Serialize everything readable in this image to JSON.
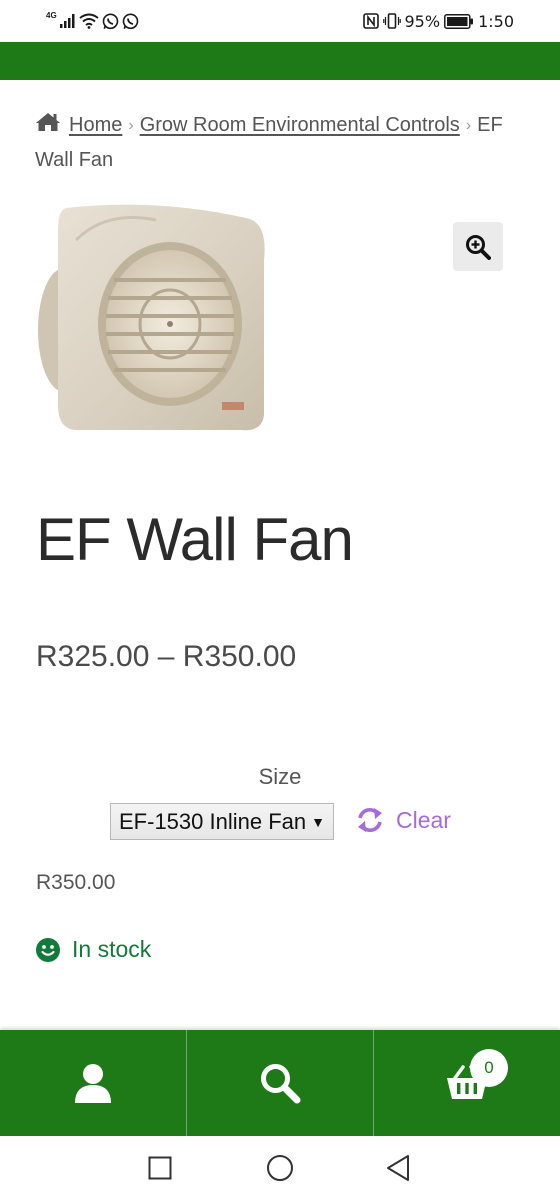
{
  "status_bar": {
    "network": "4G",
    "battery": "95%",
    "time": "1:50"
  },
  "breadcrumb": {
    "home": "Home",
    "category": "Grow Room Environmental Controls",
    "current": "EF Wall Fan"
  },
  "product": {
    "title": "EF Wall Fan",
    "price_range": "R325.00 – R350.00",
    "size_label": "Size",
    "size_selected": "EF-1530 Inline Fan",
    "clear_label": "Clear",
    "variant_price": "R350.00",
    "stock_status": "In stock"
  },
  "bottom_nav": {
    "items": [
      "account-icon",
      "search-icon",
      "cart-icon"
    ],
    "cart_count": "0"
  },
  "colors": {
    "brand_green": "#1e7a17",
    "stock_green": "#127a3a",
    "clear_purple": "#a66bdb"
  }
}
